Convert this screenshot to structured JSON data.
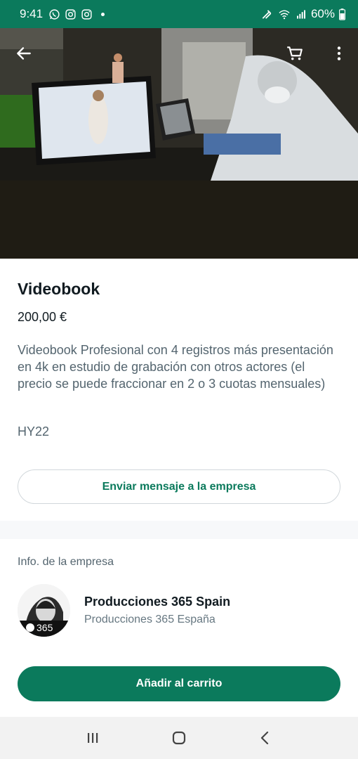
{
  "status_bar": {
    "time": "9:41",
    "battery": "60%",
    "icons_left": [
      "whatsapp-icon",
      "instagram-icon",
      "instagram-icon"
    ],
    "icons_right": [
      "signal-icon",
      "wifi-icon",
      "cell-signal-icon",
      "battery-icon"
    ]
  },
  "hero": {
    "back_icon": "arrow-back-icon",
    "cart_icon": "cart-icon",
    "menu_icon": "more-vert-icon"
  },
  "product": {
    "title": "Videobook",
    "price": "200,00 €",
    "description": "Videobook Profesional con 4 registros más presentación en 4k en estudio de grabación con otros actores (el precio se puede fraccionar en 2 o 3 cuotas mensuales)",
    "code": "HY22",
    "message_button": "Enviar mensaje a la empresa"
  },
  "company": {
    "section_label": "Info. de la empresa",
    "name": "Producciones 365 Spain",
    "subtitle": "Producciones 365 España",
    "avatar_badge": "365"
  },
  "actions": {
    "add_to_cart": "Añadir al carrito"
  },
  "nav_bar": {
    "recent_icon": "recents-icon",
    "home_icon": "home-icon",
    "back_icon": "nav-back-icon"
  },
  "colors": {
    "accent": "#0b7a5c",
    "text_primary": "#111b21",
    "text_secondary": "#54656f"
  }
}
